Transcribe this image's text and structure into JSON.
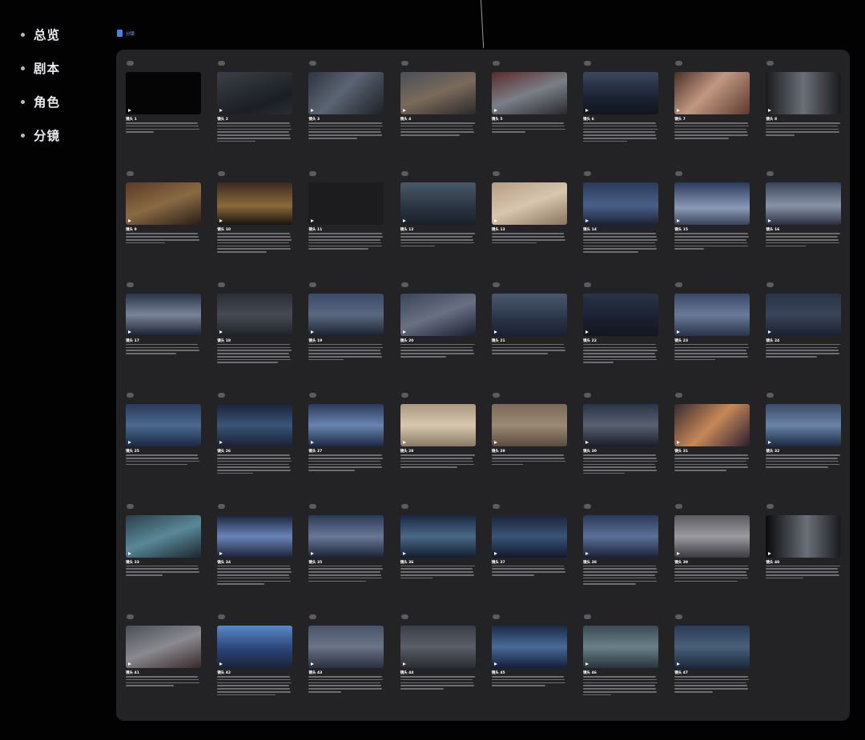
{
  "nav": {
    "items": [
      {
        "label": "总览"
      },
      {
        "label": "剧本"
      },
      {
        "label": "角色"
      },
      {
        "label": "分镜"
      }
    ]
  },
  "breadcrumb": {
    "label": "分镜"
  },
  "colors": {
    "background": "#020203",
    "panel": "#232325",
    "accent": "#4f7fe6"
  },
  "shots": [
    {
      "label": "镜头 1",
      "thumb": "#050506"
    },
    {
      "label": "镜头 2",
      "thumb": "linear-gradient(160deg,#3b4048,#1b1e23 70%,#2a2d33)"
    },
    {
      "label": "镜头 3",
      "thumb": "linear-gradient(135deg,#2d3440,#5b6472 45%,#1d2128)"
    },
    {
      "label": "镜头 4",
      "thumb": "linear-gradient(160deg,#4a4f59,#7b6a5a 50%,#2c2a2c)"
    },
    {
      "label": "镜头 5",
      "thumb": "linear-gradient(160deg,#5a2a2a,#7a7f88 50%,#2a2a2e)"
    },
    {
      "label": "镜头 6",
      "thumb": "linear-gradient(180deg,#3a4860,#1b2233 60%,#11151e)"
    },
    {
      "label": "镜头 7",
      "thumb": "linear-gradient(135deg,#4a3028,#c29880 45%,#5a3a30)"
    },
    {
      "label": "镜头 8",
      "thumb": "linear-gradient(90deg,#1a1a1c,#6a6f78 50%,#1a1a1c)"
    },
    {
      "label": "镜头 9",
      "thumb": "linear-gradient(160deg,#5a3a24,#8a6a44 50%,#2a1e16)"
    },
    {
      "label": "镜头 10",
      "thumb": "linear-gradient(180deg,#3a2a20,#8a6a3a 55%,#1a1410)"
    },
    {
      "label": "镜头 11",
      "thumb": "#1c1c1e"
    },
    {
      "label": "镜头 12",
      "thumb": "linear-gradient(180deg,#4a5868,#2a3440 60%,#1a2028)"
    },
    {
      "label": "镜头 13",
      "thumb": "linear-gradient(160deg,#b59c84,#d8c6ae 50%,#8a7560)"
    },
    {
      "label": "镜头 14",
      "thumb": "linear-gradient(180deg,#2a3a5a,#4a6088 55%,#1a2234)"
    },
    {
      "label": "镜头 15",
      "thumb": "linear-gradient(180deg,#2a3a58,#8a9ab8 60%,#3a4458)"
    },
    {
      "label": "镜头 16",
      "thumb": "linear-gradient(180deg,#3a4458,#8a94a8 55%,#2a3040)"
    },
    {
      "label": "镜头 17",
      "thumb": "linear-gradient(180deg,#2a3448,#7a8498 50%,#1a2030)"
    },
    {
      "label": "镜头 18",
      "thumb": "linear-gradient(180deg,#2a2e36,#454a54 50%,#1e2228)"
    },
    {
      "label": "镜头 19",
      "thumb": "linear-gradient(180deg,#3a4a68,#5a6880 50%,#1a2230)"
    },
    {
      "label": "镜头 20",
      "thumb": "linear-gradient(160deg,#3a4458,#6a7084 50%,#1a2030)"
    },
    {
      "label": "镜头 21",
      "thumb": "linear-gradient(180deg,#4a5870,#2a3448 60%,#1a2030)"
    },
    {
      "label": "镜头 22",
      "thumb": "linear-gradient(180deg,#2a3448,#1a2030 60%,#12161e)"
    },
    {
      "label": "镜头 23",
      "thumb": "linear-gradient(180deg,#3a4868,#6a7a98 50%,#2a3448)"
    },
    {
      "label": "镜头 24",
      "thumb": "linear-gradient(180deg,#2a3448,#3a4458 50%,#1a2030)"
    },
    {
      "label": "镜头 25",
      "thumb": "linear-gradient(180deg,#2a3a5a,#4a6890 50%,#1a2a44)"
    },
    {
      "label": "镜头 26",
      "thumb": "linear-gradient(180deg,#1a2438,#3a5478 50%,#1a2234)"
    },
    {
      "label": "镜头 27",
      "thumb": "linear-gradient(180deg,#2a3a5a,#6a84b0 50%,#1a2a44)"
    },
    {
      "label": "镜头 28",
      "thumb": "linear-gradient(180deg,#a89880,#d8c8b0 50%,#8a7a64)"
    },
    {
      "label": "镜头 29",
      "thumb": "linear-gradient(180deg,#7a6a58,#9a8a74 50%,#5a4c3e)"
    },
    {
      "label": "镜头 30",
      "thumb": "linear-gradient(180deg,#2a3448,#5a6070 50%,#1a1e28)"
    },
    {
      "label": "镜头 31",
      "thumb": "linear-gradient(135deg,#3a2a30,#c88858 50%,#2a2030)"
    },
    {
      "label": "镜头 32",
      "thumb": "linear-gradient(180deg,#3a4a68,#6a84a8 50%,#1a2a40)"
    },
    {
      "label": "镜头 33",
      "thumb": "linear-gradient(160deg,#2a4048,#5a8898 50%,#1a2830)"
    },
    {
      "label": "镜头 34",
      "thumb": "linear-gradient(180deg,#1a2438,#6a84b8 50%,#1a2438)"
    },
    {
      "label": "镜头 35",
      "thumb": "linear-gradient(180deg,#2a3a54,#6a7898 50%,#1a2436)"
    },
    {
      "label": "镜头 36",
      "thumb": "linear-gradient(180deg,#1a2840,#4a6888 50%,#12202e)"
    },
    {
      "label": "镜头 37",
      "thumb": "linear-gradient(180deg,#1a2438,#3a5478 50%,#12182a)"
    },
    {
      "label": "镜头 38",
      "thumb": "linear-gradient(180deg,#2a3a5a,#5a7098 50%,#1a2234)"
    },
    {
      "label": "镜头 39",
      "thumb": "linear-gradient(180deg,#5a5a60,#9a9aa0 50%,#3a3a40)"
    },
    {
      "label": "镜头 40",
      "thumb": "linear-gradient(90deg,#0a0a0c,#6a7078 55%,#1a1a1e)"
    },
    {
      "label": "镜头 41",
      "thumb": "linear-gradient(160deg,#4a4e58,#8a8a90 50%,#3a2a28)"
    },
    {
      "label": "镜头 42",
      "thumb": "linear-gradient(180deg,#5a88c8,#2a4478 55%,#1a2438)"
    },
    {
      "label": "镜头 43",
      "thumb": "linear-gradient(180deg,#4a5468,#6a7488 50%,#2a3040)"
    },
    {
      "label": "镜头 44",
      "thumb": "linear-gradient(180deg,#3a3e46,#5a5e66 50%,#2a2c32)"
    },
    {
      "label": "镜头 45",
      "thumb": "linear-gradient(180deg,#1a2a44,#4a6a98 50%,#12203a)"
    },
    {
      "label": "镜头 46",
      "thumb": "linear-gradient(180deg,#3a4a54,#6a8088 50%,#2a343c)"
    },
    {
      "label": "镜头 47",
      "thumb": "linear-gradient(180deg,#2a3a58,#4a6078 50%,#1a2a3c)"
    }
  ]
}
